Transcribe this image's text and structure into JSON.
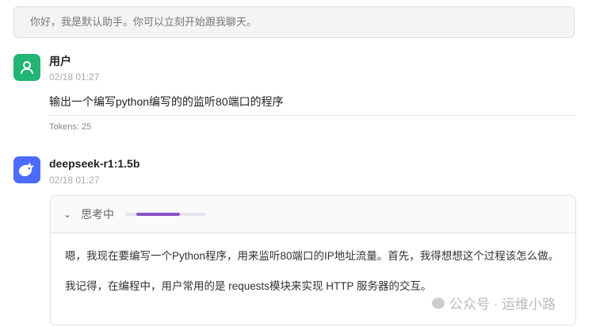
{
  "notice": "你好，我是默认助手。你可以立刻开始跟我聊天。",
  "user": {
    "name": "用户",
    "time": "02/18 01:27",
    "message": "输出一个编写python编写的的监听80端口的程序",
    "tokens": "Tokens: 25",
    "avatar_color": "#22b573"
  },
  "assistant": {
    "name": "deepseek-r1:1.5b",
    "time": "02/18 01:27",
    "avatar_color": "#4d6bfe",
    "thinking": {
      "label": "思考中",
      "progress": 0.54,
      "paragraphs": [
        "嗯，我现在要编写一个Python程序，用来监听80端口的IP地址流量。首先，我得想想这个过程该怎么做。",
        "我记得，在编程中，用户常用的是 requests模块来实现 HTTP 服务器的交互。"
      ]
    }
  },
  "watermark": "公众号 · 运维小路"
}
